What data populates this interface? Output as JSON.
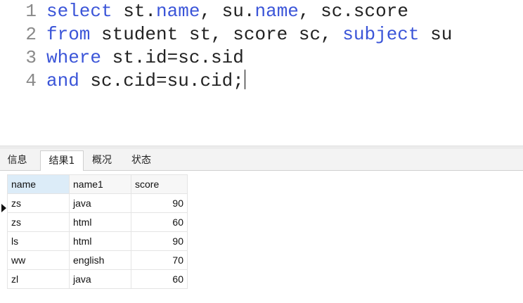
{
  "editor": {
    "lines": [
      {
        "number": "1",
        "tokens": [
          {
            "text": "select",
            "kw": true
          },
          {
            "text": " st.",
            "kw": false
          },
          {
            "text": "name",
            "kw": true
          },
          {
            "text": ", su.",
            "kw": false
          },
          {
            "text": "name",
            "kw": true
          },
          {
            "text": ", sc.score",
            "kw": false
          }
        ]
      },
      {
        "number": "2",
        "tokens": [
          {
            "text": "from",
            "kw": true
          },
          {
            "text": " student st, score sc, ",
            "kw": false
          },
          {
            "text": "subject",
            "kw": true
          },
          {
            "text": " su",
            "kw": false
          }
        ]
      },
      {
        "number": "3",
        "tokens": [
          {
            "text": "where",
            "kw": true
          },
          {
            "text": " st.id=sc.sid",
            "kw": false
          }
        ]
      },
      {
        "number": "4",
        "tokens": [
          {
            "text": "and",
            "kw": true
          },
          {
            "text": " sc.cid=su.cid;",
            "kw": false
          }
        ]
      }
    ],
    "keyword_color": "#3b55d8",
    "cursor_line": "4"
  },
  "tabs": [
    {
      "label": "信息",
      "active": false
    },
    {
      "label": "结果1",
      "active": true
    },
    {
      "label": "概况",
      "active": false
    },
    {
      "label": "状态",
      "active": false
    }
  ],
  "results": {
    "columns": [
      "name",
      "name1",
      "score"
    ],
    "selected_column": "name",
    "current_row": 1,
    "rows": [
      [
        "zs",
        "java",
        "90"
      ],
      [
        "zs",
        "html",
        "60"
      ],
      [
        "ls",
        "html",
        "90"
      ],
      [
        "ww",
        "english",
        "70"
      ],
      [
        "zl",
        "java",
        "60"
      ]
    ]
  }
}
